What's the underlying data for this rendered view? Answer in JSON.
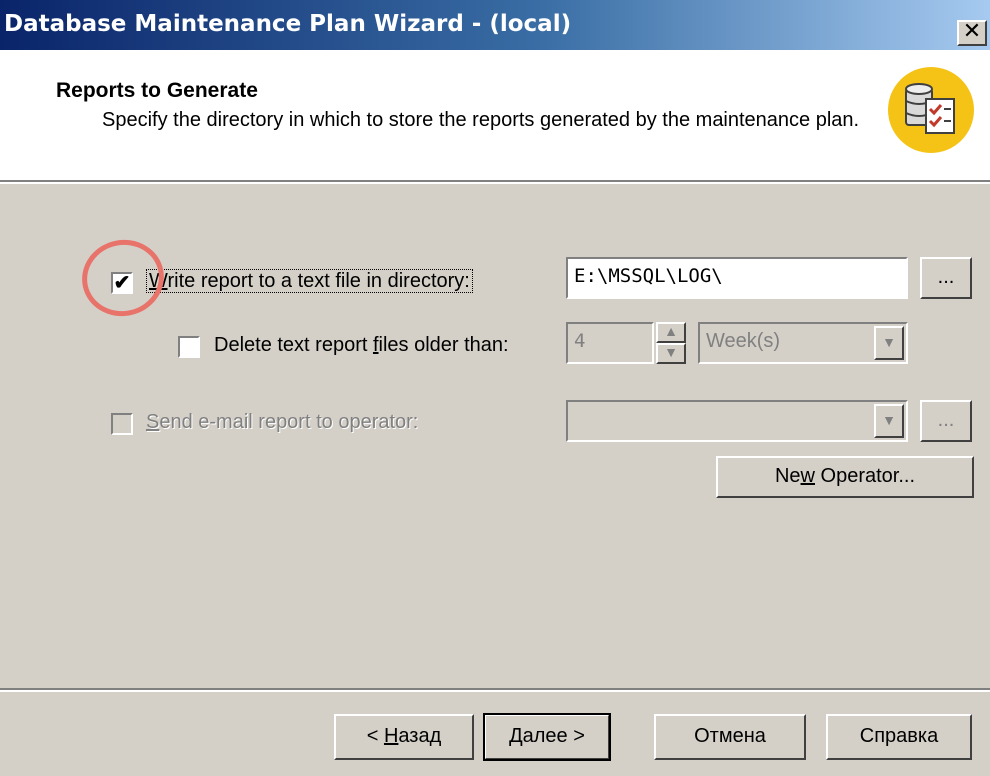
{
  "window": {
    "title": "Database Maintenance Plan Wizard - (local)",
    "close_glyph": "✕"
  },
  "header": {
    "title": "Reports to Generate",
    "subtitle": "Specify the directory in which to store the reports generated by the maintenance plan.",
    "icon": "database-report-icon"
  },
  "options": {
    "write_report": {
      "checked": true,
      "check_glyph": "✔",
      "label_prefix": "W",
      "label_rest": "rite report to a text file in directory:",
      "directory": "E:\\MSSQL\\LOG\\",
      "browse_label": "..."
    },
    "delete_old": {
      "checked": false,
      "label_pre": "Delete text report ",
      "label_accel": "f",
      "label_post": "iles older than:",
      "number": "4",
      "unit": "Week(s)"
    },
    "email_report": {
      "checked": false,
      "enabled": false,
      "label_accel": "S",
      "label_rest": "end e-mail report to operator:",
      "operator": "",
      "browse_label": "..."
    },
    "new_operator": {
      "label_pre": "Ne",
      "label_accel": "w",
      "label_post": " Operator..."
    }
  },
  "footer": {
    "back": {
      "lt": "< ",
      "accel": "Н",
      "rest": "азад"
    },
    "next": "Далее >",
    "cancel": "Отмена",
    "help": "Справка"
  },
  "colors": {
    "dialog_bg": "#d4d0c8",
    "title_start": "#0a246a",
    "title_end": "#a6caf0",
    "icon_badge": "#f4c316",
    "annotation": "#e8736a"
  }
}
